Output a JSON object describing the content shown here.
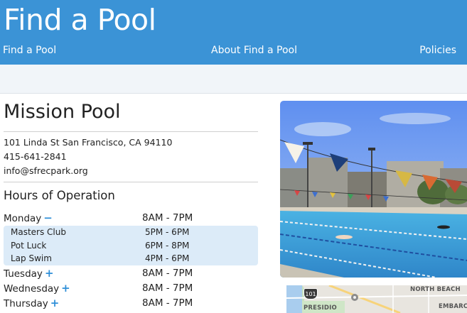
{
  "header": {
    "brand": "Find a Pool",
    "nav": {
      "find": "Find a Pool",
      "about": "About Find a Pool",
      "policies": "Policies"
    },
    "background_color": "#3b93d6"
  },
  "pool": {
    "name": "Mission Pool",
    "address": "101 Linda St San Francisco, CA 94110",
    "phone": "415-641-2841",
    "email": "info@sfrecpark.org"
  },
  "hours": {
    "title": "Hours of Operation",
    "days": [
      {
        "name": "Monday",
        "hours": "8AM - 7PM",
        "toggle": "−",
        "toggle_icon": "minus-icon",
        "expanded": true
      },
      {
        "name": "Tuesday",
        "hours": "8AM - 7PM",
        "toggle": "+",
        "toggle_icon": "plus-icon",
        "expanded": false
      },
      {
        "name": "Wednesday",
        "hours": "8AM - 7PM",
        "toggle": "+",
        "toggle_icon": "plus-icon",
        "expanded": false
      },
      {
        "name": "Thursday",
        "hours": "8AM - 7PM",
        "toggle": "+",
        "toggle_icon": "plus-icon",
        "expanded": false
      }
    ],
    "monday_activities": [
      {
        "name": "Masters Club",
        "hours": "5PM - 6PM"
      },
      {
        "name": "Pot Luck",
        "hours": "6PM - 8PM"
      },
      {
        "name": "Lap Swim",
        "hours": "4PM - 6PM"
      }
    ],
    "activity_background": "#dcebf8",
    "toggle_color": "#2f8fd8"
  },
  "map": {
    "labels": {
      "north_beach": "NORTH BEACH",
      "presidio": "PRESIDIO",
      "embarcadero": "EMBARCA"
    },
    "highway": "101"
  }
}
